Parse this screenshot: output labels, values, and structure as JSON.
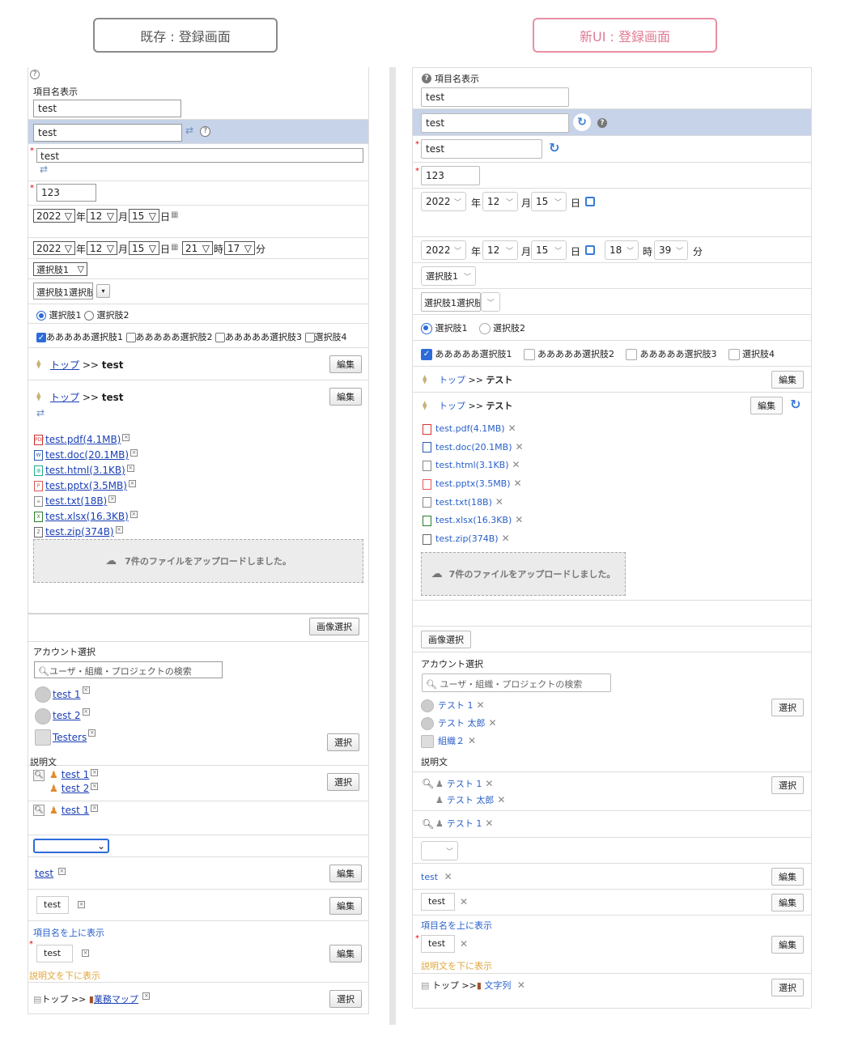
{
  "titles": {
    "left": "既存 : 登録画面",
    "right": "新UI : 登録画面"
  },
  "common": {
    "item_name_display": "項目名表示",
    "text_value": "test",
    "number_value": "123",
    "year": "2022",
    "month": "12",
    "day": "15",
    "year_unit": "年",
    "month_unit": "月",
    "day_unit": "日",
    "hour_unit": "時",
    "minute_unit": "分",
    "choice1": "選択肢1",
    "choice1_multi": "選択肢1選択肢",
    "radio1": "選択肢1",
    "radio2": "選択肢2",
    "cb1": "あああああ選択肢1",
    "cb2": "あああああ選択肢2",
    "cb3": "あああああ選択肢3",
    "cb4": "選択肢4",
    "edit": "編集",
    "select": "選択",
    "image_select": "画像選択",
    "top": "トップ",
    "sep": ">>",
    "account_select": "アカウント選択",
    "search_placeholder": "ユーザ・組織・プロジェクトの検索",
    "description": "説明文",
    "upload_msg": "7件のファイルをアップロードしました。",
    "label_above": "項目名を上に表示",
    "desc_below": "説明文を下に表示"
  },
  "old": {
    "hour": "21",
    "minute": "17",
    "crumb_tail": "test",
    "files": [
      "test.pdf(4.1MB)",
      "test.doc(20.1MB)",
      "test.html(3.1KB)",
      "test.pptx(3.5MB)",
      "test.txt(18B)",
      "test.xlsx(16.3KB)",
      "test.zip(374B)"
    ],
    "accounts": [
      "test 1",
      "test 2",
      "Testers"
    ],
    "users_a": [
      "test 1",
      "test 2"
    ],
    "users_b": [
      "test 1"
    ],
    "business_map": "業務マップ"
  },
  "new": {
    "hour": "18",
    "minute": "39",
    "crumb_tail": "テスト",
    "files": [
      "test.pdf(4.1MB)",
      "test.doc(20.1MB)",
      "test.html(3.1KB)",
      "test.pptx(3.5MB)",
      "test.txt(18B)",
      "test.xlsx(16.3KB)",
      "test.zip(374B)"
    ],
    "accounts": [
      "テスト 1",
      "テスト 太郎",
      "組織２"
    ],
    "users_a": [
      "テスト 1",
      "テスト 太郎"
    ],
    "users_b": [
      "テスト 1"
    ],
    "string_item": "文字列"
  },
  "colors": {
    "left_border": "#8a8a8a",
    "right_border": "#ea8fa3",
    "highlight": "#c6d3e8",
    "accent": "#3a7bd5"
  }
}
